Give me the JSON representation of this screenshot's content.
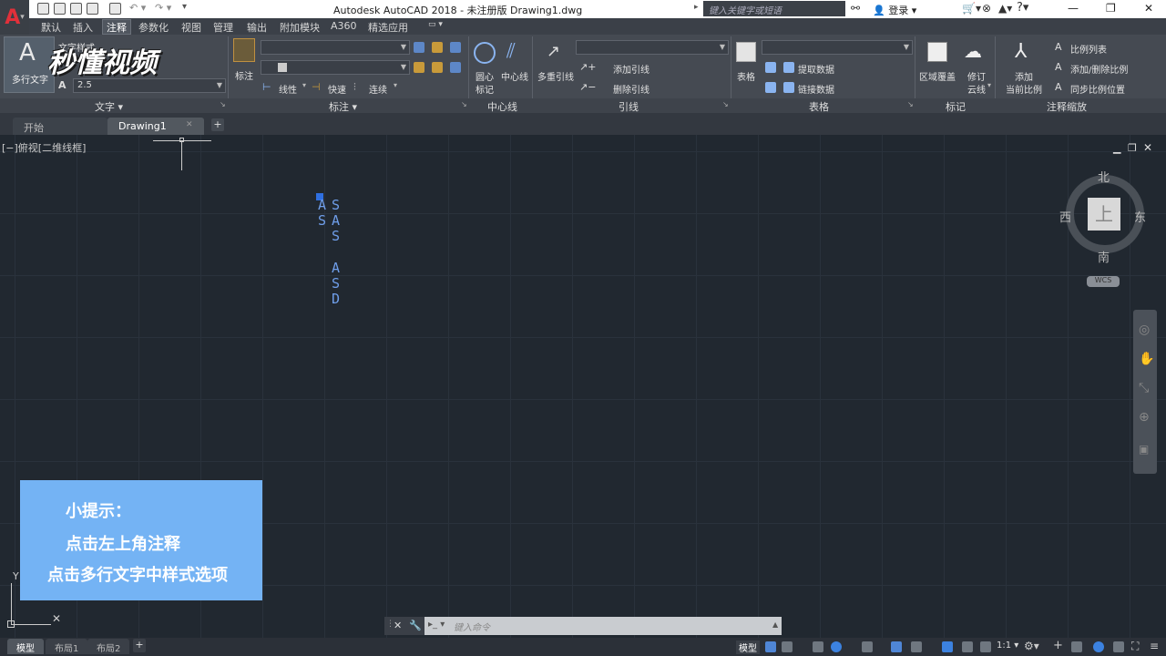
{
  "app": {
    "title": "Autodesk AutoCAD 2018 - 未注册版    Drawing1.dwg",
    "search_placeholder": "键入关键字或短语",
    "login_label": "登录"
  },
  "ribbon_tabs": [
    "默认",
    "插入",
    "注释",
    "参数化",
    "视图",
    "管理",
    "输出",
    "附加模块",
    "A360",
    "精选应用"
  ],
  "ribbon": {
    "text_panel": {
      "title": "文字",
      "mtext_label": "多行文字",
      "style_label": "文字样式",
      "height_value": "2.5"
    },
    "dim_panel": {
      "title": "标注",
      "dim_label": "标注",
      "linear_label": "线性",
      "quick_label": "快速",
      "continue_label": "连续"
    },
    "center_panel": {
      "title": "中心线",
      "center_mark": "圆心\n标记",
      "center_mark_l1": "圆心",
      "center_mark_l2": "标记",
      "center_line": "中心线"
    },
    "leader_panel": {
      "title": "引线",
      "multileader": "多重引线",
      "add_leader": "添加引线",
      "remove_leader": "删除引线"
    },
    "table_panel": {
      "title": "表格",
      "table_label": "表格",
      "extract": "提取数据",
      "link": "链接数据"
    },
    "markup_panel": {
      "title": "标记",
      "wipeout": "区域覆盖",
      "revcloud_l1": "修订",
      "revcloud_l2": "云线"
    },
    "scale_panel": {
      "title": "注释缩放",
      "add_l1": "添加",
      "add_l2": "当前比例",
      "scale_list": "比例列表",
      "add_delete": "添加/删除比例",
      "sync": "同步比例位置"
    }
  },
  "file_tabs": {
    "start": "开始",
    "drawing": "Drawing1",
    "plus": "+"
  },
  "viewport_label": "[−]俯视[二维线框]",
  "drawing_text": {
    "col1": [
      "A",
      "S"
    ],
    "col2": [
      "S",
      "A",
      "S",
      "",
      "A",
      "S",
      "D"
    ]
  },
  "compass": {
    "north": "北",
    "south": "南",
    "east": "东",
    "west": "西",
    "top": "上",
    "wcs": "WCS"
  },
  "tip": {
    "line1": "小提示：",
    "line2": "点击左上角注释",
    "line3": "点击多行文字中样式选项"
  },
  "command_line": {
    "placeholder": "键入命令"
  },
  "status": {
    "tabs": [
      "模型",
      "布局1",
      "布局2"
    ],
    "model_label": "模型",
    "scale": "1:1"
  },
  "watermark": "秒懂视频",
  "colors": {
    "accent": "#74b3f4",
    "cad_text": "#6f9eea",
    "background": "#212830"
  }
}
